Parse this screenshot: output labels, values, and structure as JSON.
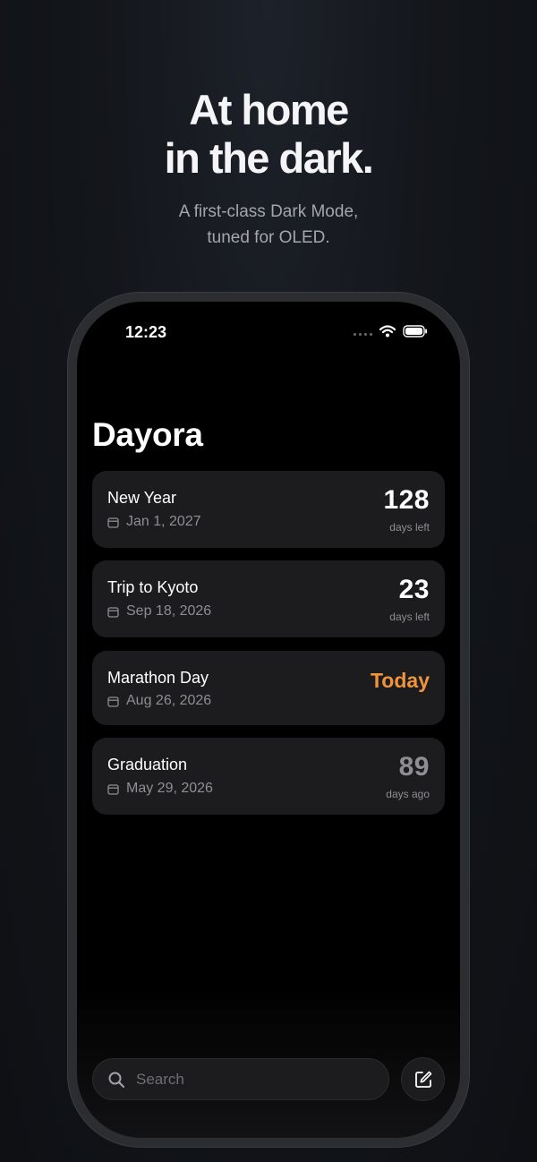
{
  "promo": {
    "headline_line1": "At home",
    "headline_line2": "in the dark.",
    "subtitle_line1": "A first-class Dark Mode,",
    "subtitle_line2": "tuned for OLED."
  },
  "status_bar": {
    "time": "12:23",
    "icons": [
      "signal-dots-icon",
      "wifi-icon",
      "battery-icon"
    ]
  },
  "app": {
    "title": "Dayora",
    "accent_color": "#f0943b"
  },
  "events": [
    {
      "name": "New Year",
      "date": "Jan 1, 2027",
      "value": "128",
      "unit": "days left"
    },
    {
      "name": "Trip to Kyoto",
      "date": "Sep 18, 2026",
      "value": "23",
      "unit": "days left"
    },
    {
      "name": "Marathon Day",
      "date": "Aug 26, 2026",
      "value": "Today",
      "unit": ""
    },
    {
      "name": "Graduation",
      "date": "May 29, 2026",
      "value": "89",
      "unit": "days ago"
    }
  ],
  "bottom_bar": {
    "search_placeholder": "Search",
    "search_value": "",
    "search_icon": "search-icon",
    "compose_icon": "compose-icon"
  }
}
